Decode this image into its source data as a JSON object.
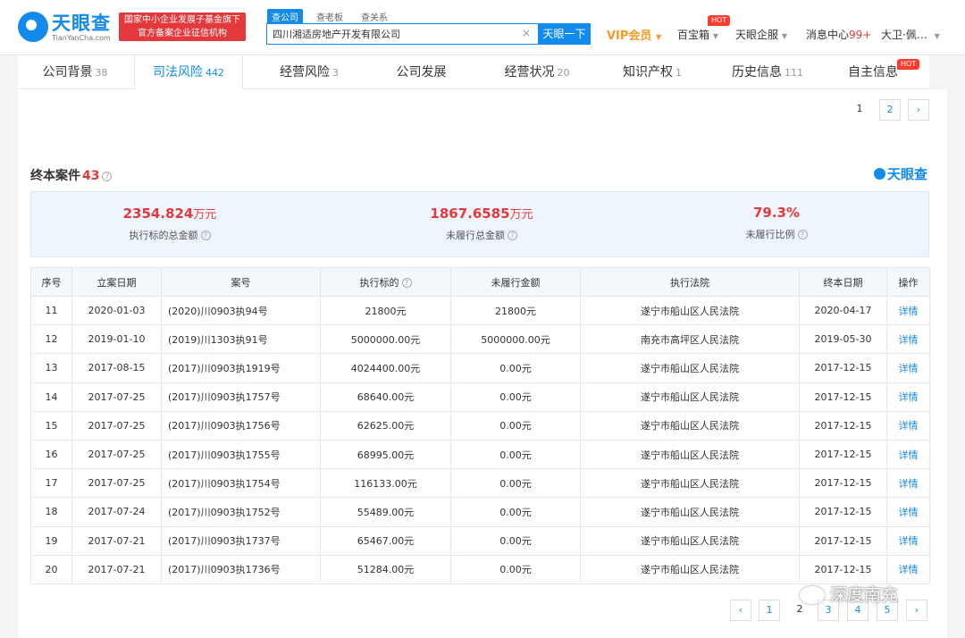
{
  "header": {
    "logo_name": "天眼查",
    "logo_sub": "TianYanCha.com",
    "badge_line1": "国家中小企业发展子基金旗下",
    "badge_line2": "官方备案企业征信机构",
    "search_tabs": [
      "查公司",
      "查老板",
      "查关系"
    ],
    "search_value": "四川湘适房地产开发有限公司",
    "search_button": "天眼一下",
    "nav": {
      "vip": "VIP会员",
      "baibaoxiang": "百宝箱",
      "hot_label": "HOT",
      "qiye": "天眼企服",
      "message": "消息中心",
      "message_count": "99+",
      "user": "大卫·佩…"
    }
  },
  "tabs": [
    {
      "label": "公司背景",
      "count": "38"
    },
    {
      "label": "司法风险",
      "count": "442"
    },
    {
      "label": "经营风险",
      "count": "3"
    },
    {
      "label": "公司发展",
      "count": ""
    },
    {
      "label": "经营状况",
      "count": "20"
    },
    {
      "label": "知识产权",
      "count": "1"
    },
    {
      "label": "历史信息",
      "count": "111"
    },
    {
      "label": "自主信息",
      "count": ""
    }
  ],
  "tab_hot": "HOT",
  "top_pager": [
    "1",
    "2",
    "›"
  ],
  "section": {
    "title": "终本案件",
    "count": "43",
    "brand": "天眼查"
  },
  "summary": [
    {
      "value": "2354.824",
      "unit": "万元",
      "label": "执行标的总金额"
    },
    {
      "value": "1867.6585",
      "unit": "万元",
      "label": "未履行总金额"
    },
    {
      "value": "79.3%",
      "unit": "",
      "label": "未履行比例"
    }
  ],
  "table": {
    "headers": [
      "序号",
      "立案日期",
      "案号",
      "执行标的",
      "未履行金额",
      "执行法院",
      "终本日期",
      "操作"
    ],
    "rows": [
      [
        "11",
        "2020-01-03",
        "(2020)川0903执94号",
        "21800元",
        "21800元",
        "遂宁市船山区人民法院",
        "2020-04-17",
        "详情"
      ],
      [
        "12",
        "2019-01-10",
        "(2019)川1303执91号",
        "5000000.00元",
        "5000000.00元",
        "南充市高坪区人民法院",
        "2019-05-30",
        "详情"
      ],
      [
        "13",
        "2017-08-15",
        "(2017)川0903执1919号",
        "4024400.00元",
        "0.00元",
        "遂宁市船山区人民法院",
        "2017-12-15",
        "详情"
      ],
      [
        "14",
        "2017-07-25",
        "(2017)川0903执1757号",
        "68640.00元",
        "0.00元",
        "遂宁市船山区人民法院",
        "2017-12-15",
        "详情"
      ],
      [
        "15",
        "2017-07-25",
        "(2017)川0903执1756号",
        "62625.00元",
        "0.00元",
        "遂宁市船山区人民法院",
        "2017-12-15",
        "详情"
      ],
      [
        "16",
        "2017-07-25",
        "(2017)川0903执1755号",
        "68995.00元",
        "0.00元",
        "遂宁市船山区人民法院",
        "2017-12-15",
        "详情"
      ],
      [
        "17",
        "2017-07-25",
        "(2017)川0903执1754号",
        "116133.00元",
        "0.00元",
        "遂宁市船山区人民法院",
        "2017-12-15",
        "详情"
      ],
      [
        "18",
        "2017-07-24",
        "(2017)川0903执1752号",
        "55489.00元",
        "0.00元",
        "遂宁市船山区人民法院",
        "2017-12-15",
        "详情"
      ],
      [
        "19",
        "2017-07-21",
        "(2017)川0903执1737号",
        "65467.00元",
        "0.00元",
        "遂宁市船山区人民法院",
        "2017-12-15",
        "详情"
      ],
      [
        "20",
        "2017-07-21",
        "(2017)川0903执1736号",
        "51284.00元",
        "0.00元",
        "遂宁市船山区人民法院",
        "2017-12-15",
        "详情"
      ]
    ]
  },
  "bottom_pager": [
    "‹",
    "1",
    "2",
    "3",
    "4",
    "5",
    "›"
  ],
  "watermark": "深度南充"
}
